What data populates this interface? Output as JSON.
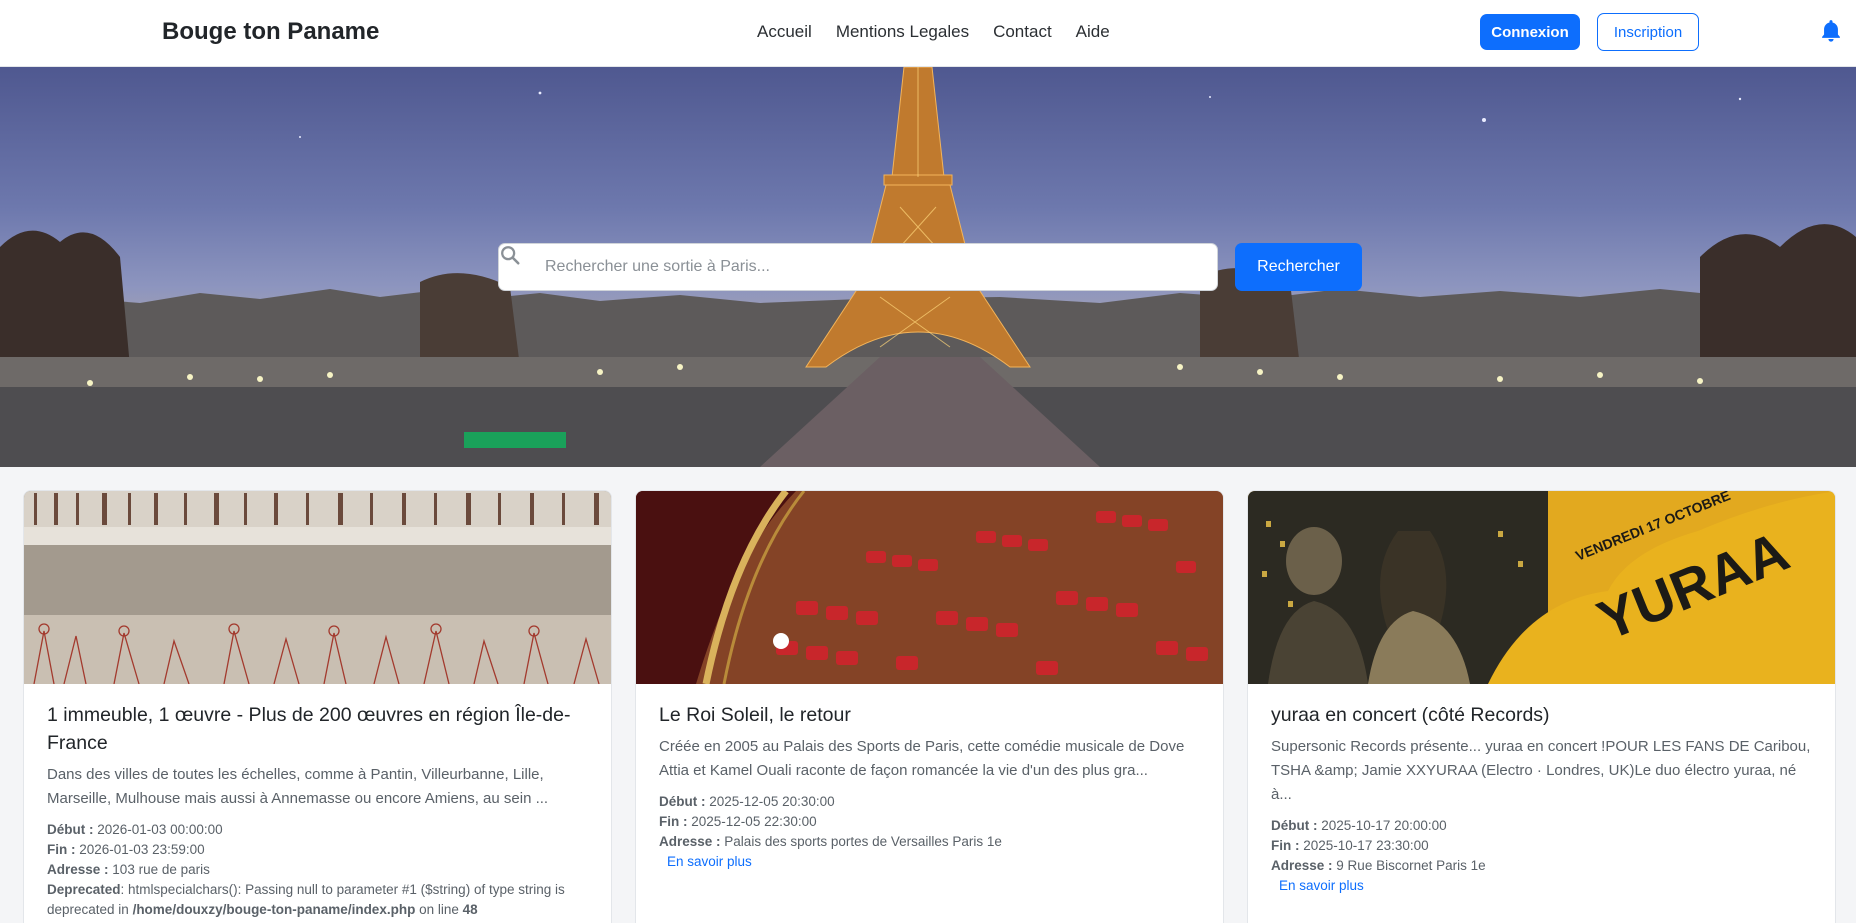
{
  "nav": {
    "brand": "Bouge ton Paname",
    "links": [
      "Accueil",
      "Mentions Legales",
      "Contact",
      "Aide"
    ],
    "login": "Connexion",
    "signup": "Inscription"
  },
  "search": {
    "placeholder": "Rechercher une sortie à Paris...",
    "button": "Rechercher"
  },
  "labels": {
    "start": "Début :",
    "end": "Fin :",
    "address": "Adresse :",
    "more": "En savoir plus"
  },
  "cards": [
    {
      "title": "1 immeuble, 1 œuvre - Plus de 200 œuvres en région Île-de-France",
      "description": "Dans des villes de toutes les échelles, comme à Pantin, Villeurbanne, Lille, Marseille, Mulhouse mais aussi à Annemasse ou encore Amiens, au sein ...",
      "start": "2026-01-03 00:00:00",
      "end": "2026-01-03 23:59:00",
      "address": "103 rue de paris",
      "warning": {
        "label": "Deprecated",
        "text": ": htmlspecialchars(): Passing null to parameter #1 ($string) of type string is deprecated in ",
        "path": "/home/douxzy/bouge-ton-paname/index.php",
        "line_text": " on line ",
        "line": "48"
      }
    },
    {
      "title": "Le Roi Soleil, le retour",
      "description": "Créée en 2005 au Palais des Sports de Paris, cette comédie musicale de Dove Attia et Kamel Ouali raconte de façon romancée la vie d'un des plus gra...",
      "start": "2025-12-05 20:30:00",
      "end": "2025-12-05 22:30:00",
      "address": "Palais des sports portes de Versailles Paris 1e"
    },
    {
      "title": "yuraa en concert (côté Records)",
      "description": "Supersonic Records présente... yuraa en concert !POUR LES FANS DE Caribou, TSHA &amp; Jamie XXYURAA (Electro · Londres, UK)Le duo électro yuraa, né à...",
      "start": "2025-10-17 20:00:00",
      "end": "2025-10-17 23:30:00",
      "address": "9 Rue Biscornet Paris 1e",
      "poster_text": [
        "VENDREDI 17 OCTOBRE",
        "YURAA"
      ]
    }
  ],
  "colors": {
    "primary": "#0d6efd",
    "text": "#212529",
    "muted": "#5a6168"
  }
}
